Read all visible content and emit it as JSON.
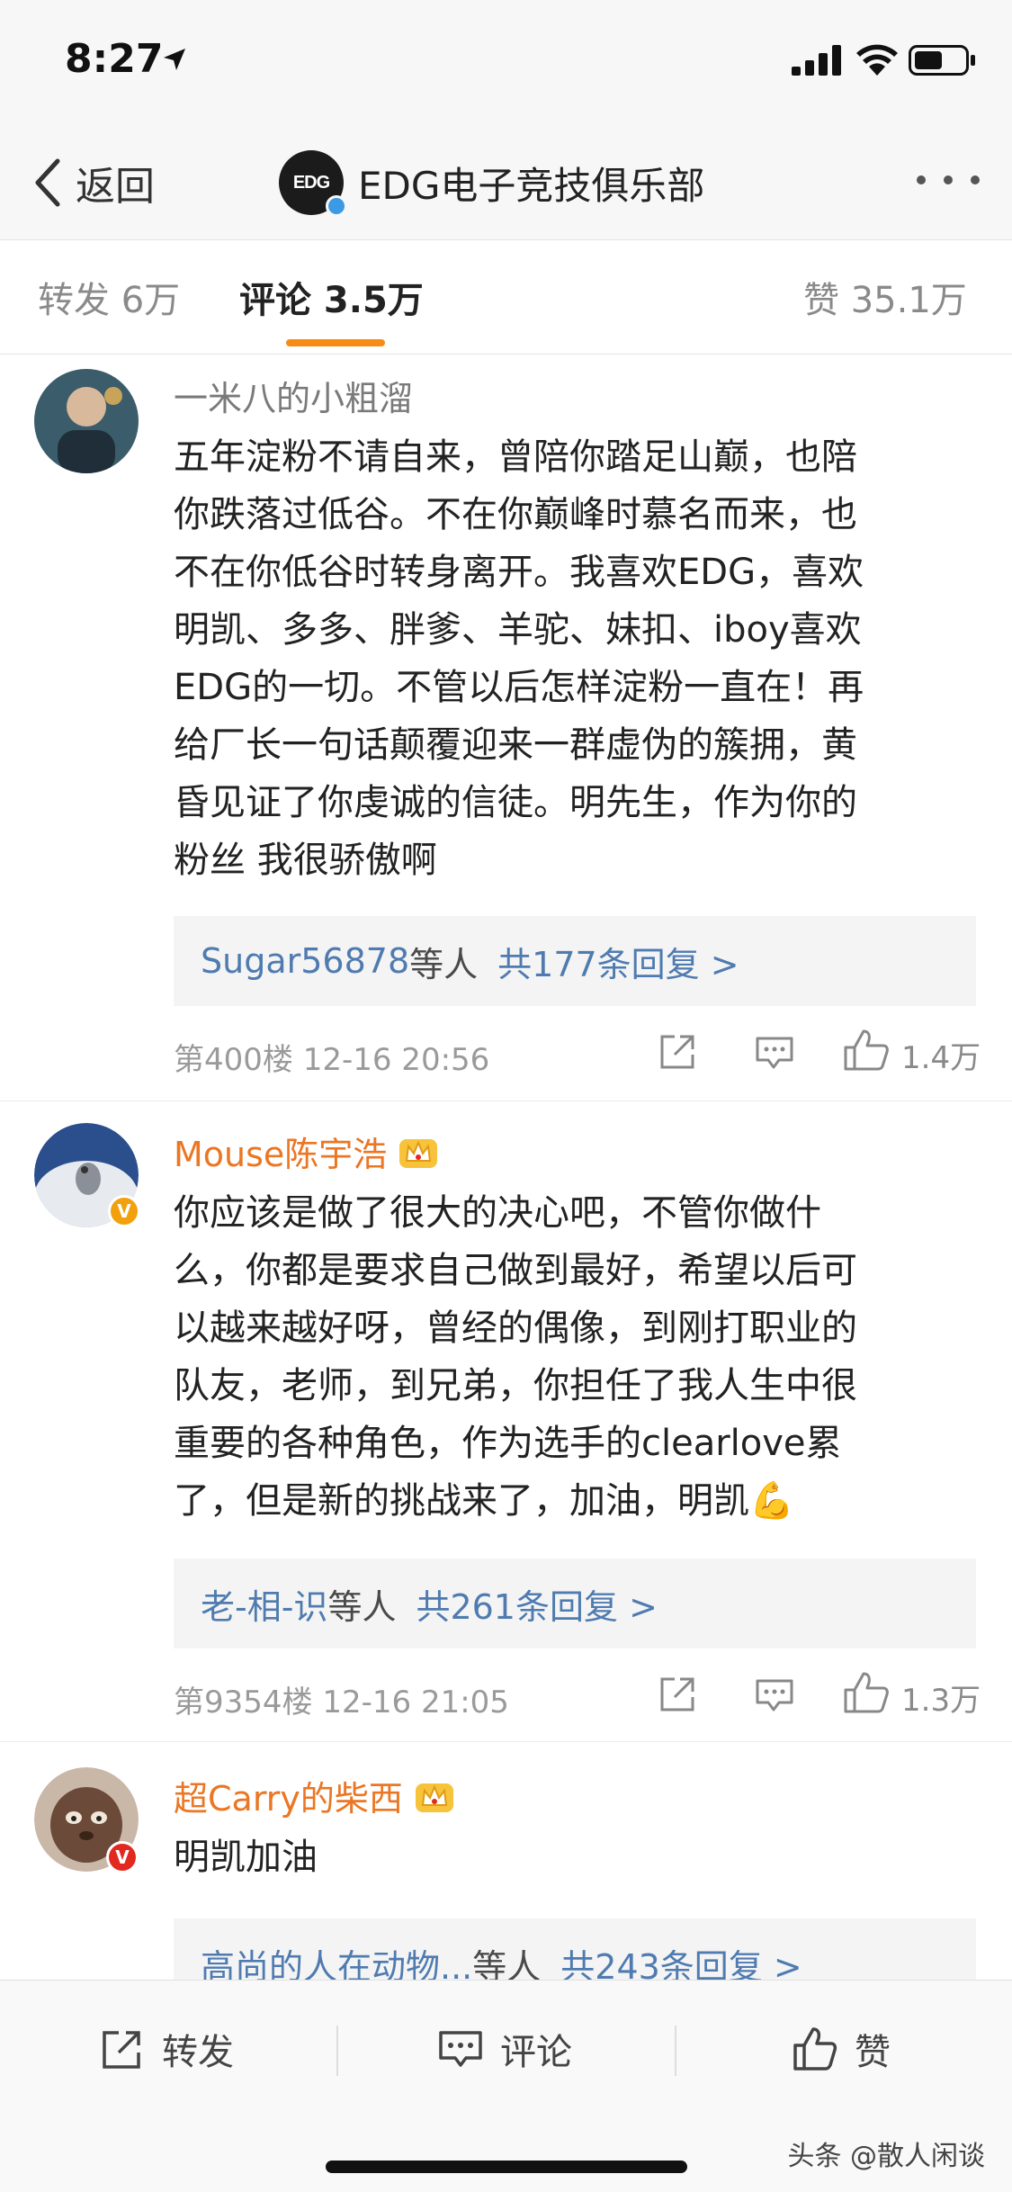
{
  "status_bar": {
    "time": "8:27"
  },
  "nav": {
    "back_label": "返回",
    "title": "EDG电子竞技俱乐部",
    "avatar_text": "EDG"
  },
  "tabs": [
    {
      "label": "转发 6万"
    },
    {
      "label": "评论 3.5万"
    },
    {
      "label": "赞 35.1万"
    }
  ],
  "comments": [
    {
      "user": "一米八的小粗溜",
      "lines": [
        "五年淀粉不请自来，曾陪你踏足山巅，也陪",
        "你跌落过低谷。不在你巅峰时慕名而来，也",
        "不在你低谷时转身离开。我喜欢EDG，喜欢",
        "明凯、多多、胖爹、羊驼、妹扣、iboy喜欢",
        "EDG的一切。不管以后怎样淀粉一直在！再",
        "给厂长一句话颠覆迎来一群虚伪的簇拥，黄",
        "昏见证了你虔诚的信徒。明先生，作为你的",
        "粉丝 我很骄傲啊"
      ],
      "reply_user": "Sugar56878",
      "reply_mid": "等人",
      "reply_link": "共177条回复 >",
      "meta": "第400楼 12-16 20:56",
      "likes": "1.4万"
    },
    {
      "user": "Mouse陈宇浩",
      "lines": [
        "你应该是做了很大的决心吧，不管你做什",
        "么，你都是要求自己做到最好，希望以后可",
        "以越来越好呀，曾经的偶像，到刚打职业的",
        "队友，老师，到兄弟，你担任了我人生中很",
        "重要的各种角色，作为选手的clearlove累",
        "了，但是新的挑战来了，加油，明凯"
      ],
      "emoji": "💪",
      "reply_user": "老-相-识",
      "reply_mid": "等人",
      "reply_link": "共261条回复 >",
      "meta": "第9354楼 12-16 21:05",
      "likes": "1.3万"
    },
    {
      "user": "超Carry的柴西",
      "lines": [
        "明凯加油"
      ],
      "reply_user": "高尚的人在动物...",
      "reply_mid": "等人",
      "reply_link": "共243条回复 >"
    }
  ],
  "toolbar": {
    "repost": "转发",
    "comment": "评论",
    "like": "赞"
  },
  "watermark": "头条 @散人闲谈",
  "colors": {
    "accent": "#f78b14",
    "username_orange": "#eb7623",
    "link_blue": "#4f7bb0",
    "verified_blue": "#3b9ae6"
  },
  "icons": [
    "location-arrow-icon",
    "signal-icon",
    "wifi-icon",
    "battery-icon",
    "back-chevron-icon",
    "more-icon",
    "crown-icon",
    "share-icon",
    "comment-icon",
    "like-icon"
  ]
}
